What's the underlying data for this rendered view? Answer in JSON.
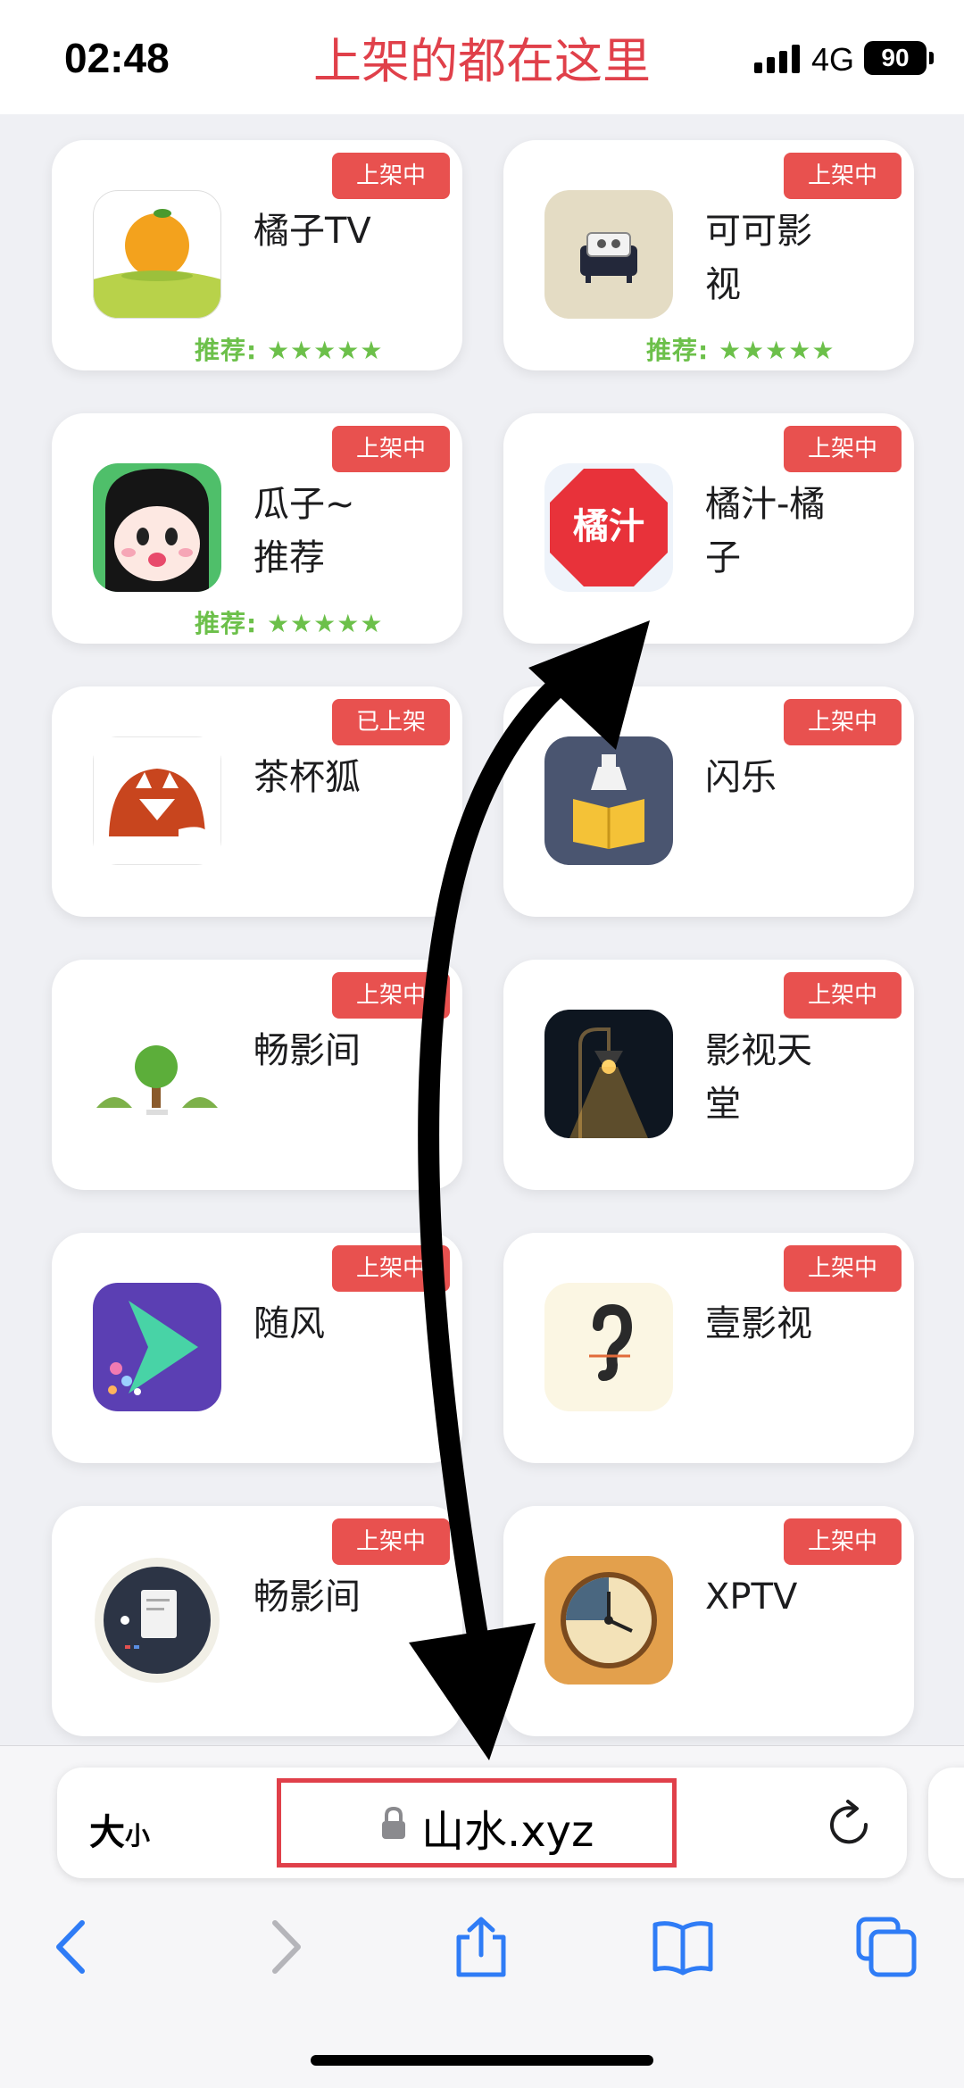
{
  "status_bar": {
    "time": "02:48",
    "network": "4G",
    "battery": "90"
  },
  "overlay_title": "上架的都在这里",
  "apps": [
    {
      "name": "橘子TV",
      "badge": "上架中",
      "rating": "推荐: ★★★★★",
      "icon": "orange-icon"
    },
    {
      "name": "可可影视",
      "badge": "上架中",
      "rating": "推荐: ★★★★★",
      "icon": "sofa-icon"
    },
    {
      "name": "瓜子~推荐",
      "badge": "上架中",
      "rating": "推荐: ★★★★★",
      "icon": "cartoon-face-icon"
    },
    {
      "name": "橘汁-橘子",
      "badge": "上架中",
      "rating": "",
      "icon_text": "橘汁",
      "icon": "juzhi-logo-icon"
    },
    {
      "name": "茶杯狐",
      "badge": "已上架",
      "rating": "",
      "icon": "fox-icon"
    },
    {
      "name": "闪乐",
      "badge": "上架中",
      "rating": "",
      "icon": "book-bottle-icon"
    },
    {
      "name": "畅影间",
      "badge": "上架中",
      "rating": "",
      "icon": "tree-icon"
    },
    {
      "name": "影视天堂",
      "badge": "上架中",
      "rating": "",
      "icon": "lamp-icon"
    },
    {
      "name": "随风",
      "badge": "上架中",
      "rating": "",
      "icon": "play-arrow-icon"
    },
    {
      "name": "壹影视",
      "badge": "上架中",
      "rating": "",
      "icon": "ear-icon"
    },
    {
      "name": "畅影间",
      "badge": "上架中",
      "rating": "",
      "icon": "document-icon"
    },
    {
      "name": "XPTV",
      "badge": "上架中",
      "rating": "",
      "icon": "clock-icon"
    }
  ],
  "browser": {
    "text_size_big": "大",
    "text_size_small": "小",
    "url": "山水.xyz"
  },
  "colors": {
    "badge": "#e8514f",
    "rating": "#6cc04a",
    "accent": "#e0404a",
    "ios_blue": "#2f7cf6"
  }
}
